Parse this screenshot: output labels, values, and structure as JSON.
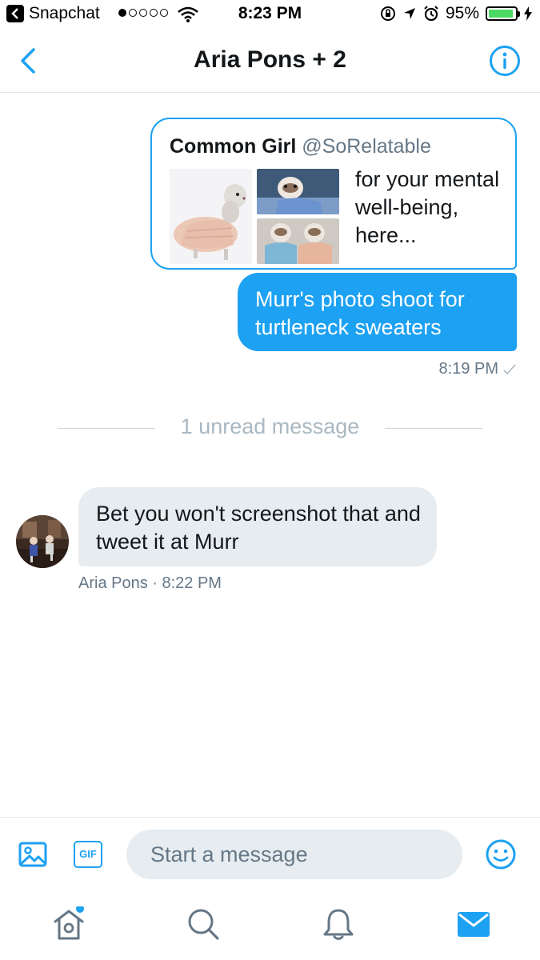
{
  "status_bar": {
    "back_app": "Snapchat",
    "time": "8:23 PM",
    "battery_percent": "95%",
    "battery_level": 0.95,
    "signal_bars_filled": 1,
    "signal_bars_total": 5
  },
  "header": {
    "title": "Aria Pons + 2"
  },
  "conversation": {
    "shared_tweet": {
      "author_name": "Common Girl",
      "author_handle": "@SoRelatable",
      "text": "for your mental well-being, here..."
    },
    "outgoing_message": {
      "text": "Murr's photo shoot for turtleneck sweaters",
      "time": "8:19 PM"
    },
    "unread_divider": "1 unread message",
    "incoming_message": {
      "text": "Bet you won't screenshot that and tweet it at Murr",
      "meta": "Aria Pons · 8:22 PM"
    }
  },
  "composer": {
    "gif_label": "GIF",
    "placeholder": "Start a message"
  },
  "tabbar": {
    "items": [
      "home-icon",
      "search-icon",
      "notifications-icon",
      "messages-icon"
    ],
    "active": "messages-icon",
    "home_has_badge": true
  },
  "colors": {
    "accent": "#1da1f2",
    "bubble_incoming": "#e6ecf0",
    "secondary_text": "#657786",
    "divider_text": "#aab8c2",
    "battery": "#4cd964"
  }
}
